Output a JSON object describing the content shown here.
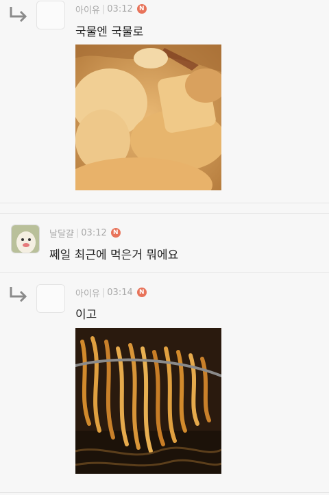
{
  "comments": [
    {
      "author": "아이유",
      "time": "03:12",
      "badge": "N",
      "text": "국물엔 국물로",
      "photo": "fishcake-soup-photo"
    },
    {
      "author": "날달걀",
      "time": "03:12",
      "badge": "N",
      "text": "쩨일 최근에 먹은거 뭐에요"
    },
    {
      "author": "아이유",
      "time": "03:14",
      "badge": "N",
      "text": "이고",
      "photo": "jjajang-noodles-photo"
    }
  ],
  "colors": {
    "badge": "#e8735a",
    "meta": "#a9a9a9",
    "background": "#f7f7f7"
  }
}
